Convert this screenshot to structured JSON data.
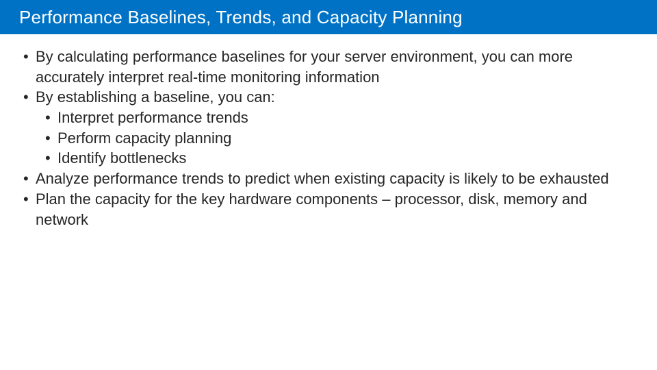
{
  "title": "Performance Baselines, Trends, and Capacity Planning",
  "bullets": [
    {
      "text": "By calculating performance baselines for your server environment, you can more accurately interpret real-time monitoring information"
    },
    {
      "text": "By establishing a baseline, you can:",
      "sub": [
        "Interpret performance trends",
        "Perform capacity planning",
        "Identify bottlenecks"
      ]
    },
    {
      "text": "Analyze performance trends to predict when existing capacity is likely to be exhausted"
    },
    {
      "text": "Plan the capacity for the key hardware components – processor, disk, memory and network"
    }
  ]
}
